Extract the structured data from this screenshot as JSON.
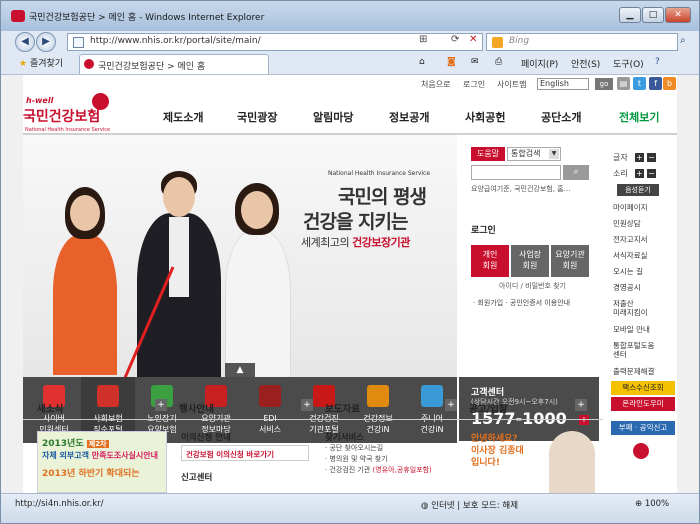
{
  "window": {
    "title": "국민건강보험공단 > 메인 홈 - Windows Internet Explorer"
  },
  "address": {
    "url": "http://www.nhis.or.kr/portal/site/main/",
    "search_placeholder": "Bing"
  },
  "favorites": {
    "label": "즐겨찾기",
    "tab_title": "국민건강보험공단 > 메인 홈"
  },
  "commands": {
    "page": "페이지(P)",
    "safety": "안전(S)",
    "tools": "도구(O)"
  },
  "site": {
    "util": {
      "home": "처음으로",
      "login": "로그인",
      "sitemap": "사이트맵",
      "lang": "English",
      "go": "go"
    },
    "logo": {
      "hwell": "h-well",
      "name": "국민건강보험",
      "en": "National Health Insurance Service"
    },
    "gnb": [
      "제도소개",
      "국민광장",
      "알림마당",
      "정보공개",
      "사회공헌",
      "공단소개",
      "전체보기"
    ],
    "hero": {
      "sub": "National Health Insurance Service",
      "line1": "국민의 평생",
      "line2": "건강을 지키는",
      "line3_plain": "세계최고의 ",
      "line3_strong": "건강보장기관"
    },
    "quick": [
      {
        "label": "사이버\n민원센터",
        "color": "#e03030"
      },
      {
        "label": "사회보험\n징수포털",
        "color": "#d0302a"
      },
      {
        "label": "노인장기\n요양보험",
        "color": "#3aa040"
      },
      {
        "label": "요양기관\n정보마당",
        "color": "#c82020"
      },
      {
        "label": "EDI\n서비스",
        "color": "#9a2020"
      },
      {
        "label": "건강검진\n기관포털",
        "color": "#c81818"
      },
      {
        "label": "건강정보\n건강iN",
        "color": "#e08a10"
      },
      {
        "label": "주니어\n건강iN",
        "color": "#3a9ad8"
      }
    ],
    "search": {
      "tab": "도움말",
      "select": "통합검색",
      "button": "검색",
      "keywords": "요양급여기준, 국민건강보험, 홈…"
    },
    "login": {
      "title": "로그인",
      "buttons": [
        {
          "label": "개인\n회원",
          "color": "#c8102e"
        },
        {
          "label": "사업장\n회원",
          "color": "#666666"
        },
        {
          "label": "요양기관\n회원",
          "color": "#666666"
        }
      ],
      "find": "아이디 / 비밀번호 찾기",
      "join": "· 회원가입   · 공인인증서 이용안내"
    },
    "cs": {
      "title": "고객센터",
      "hours": "(상담시간 오전9시~오후7시)",
      "phone": "1577-1000"
    },
    "right": {
      "font_label": "글자",
      "sound_label": "소리",
      "listen": "음성듣기",
      "menu": [
        "마이페이지",
        "민원상담",
        "전자고지서",
        "서식자료실",
        "오시는 길",
        "경영공시",
        "저출산\n미래지킴이",
        "모바일 안내",
        "통합포털도움\n센터",
        "출력문제해결"
      ],
      "receipt": "팩스수신조회",
      "online": "온라인도우미",
      "report": "부패 · 공익신고"
    },
    "boards": [
      "새소식",
      "행사안내",
      "보도자료",
      "공고/입찰"
    ],
    "banner": {
      "year": "2013년도",
      "badge": "제2차",
      "l2a": "자체 외부고객 ",
      "l2b": "만족도조사실시안내",
      "l3": "2013년 하반기 확대되는"
    },
    "sched": {
      "title": "이의신청 안내",
      "row_strong": "건강보험 이의신청",
      "row_plain": " 바로가기",
      "title2": "신고센터"
    },
    "svc": {
      "title": "찾기서비스",
      "items": [
        "· 공단 찾아오시는길",
        "· 병의원 및 약국 찾기"
      ],
      "item3_plain": "· 건강검진 기관 ",
      "item3_strong": "(영유아,공휴일포함)"
    },
    "ceo": {
      "quote": "안녕하세요?\n이사장 김종대\n입니다!"
    }
  },
  "status": {
    "url": "http://si4n.nhis.or.kr/",
    "zone": "인터넷 | 보호 모드: 해제",
    "zoom": "100%"
  }
}
